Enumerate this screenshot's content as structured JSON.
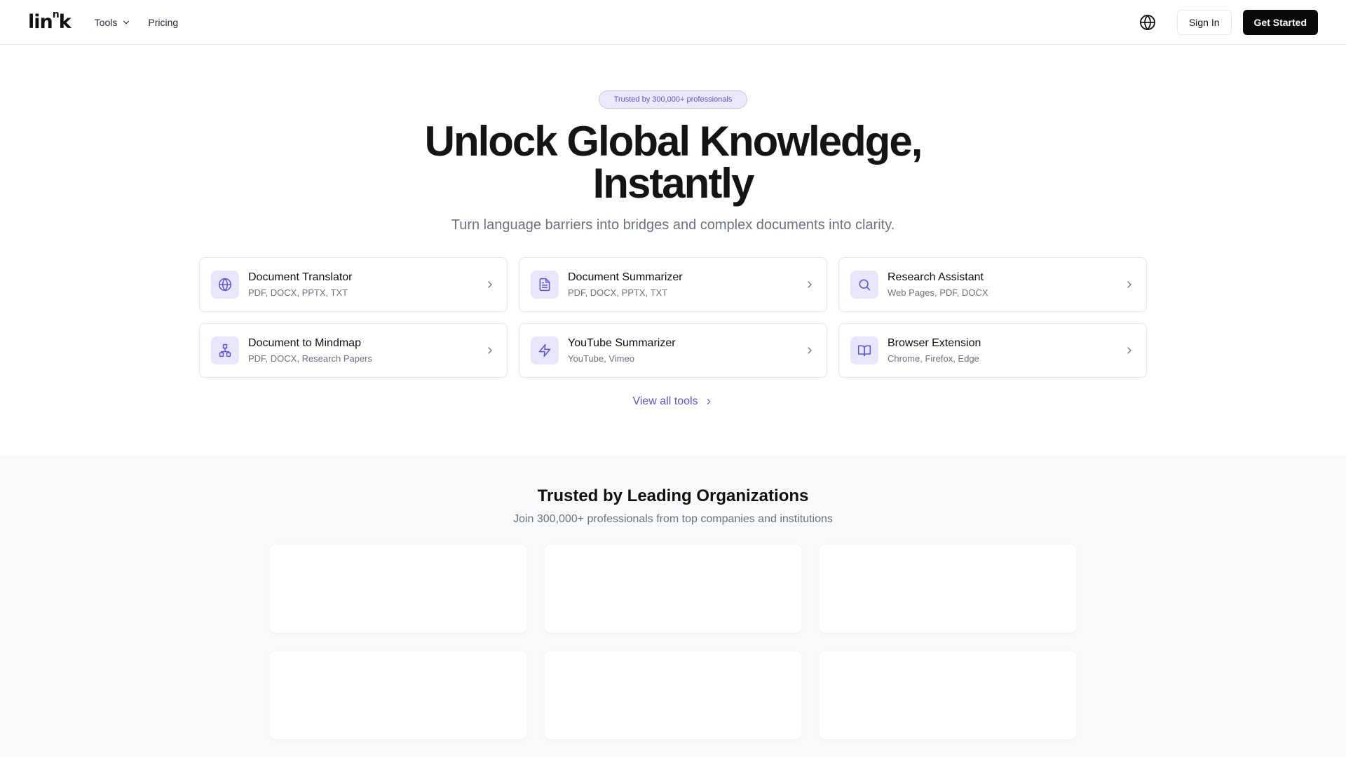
{
  "header": {
    "logo_text": "lin",
    "logo_sup": "n",
    "logo_tail": "k",
    "nav": [
      {
        "label": "Tools"
      },
      {
        "label": "Pricing"
      }
    ],
    "sign_in_label": "Sign In",
    "get_started_label": "Get Started"
  },
  "hero": {
    "badge": "Trusted by 300,000+ professionals",
    "title_line1": "Unlock Global Knowledge,",
    "title_line2": "Instantly",
    "subtitle": "Turn language barriers into bridges and complex documents into clarity.",
    "tools": [
      {
        "name": "Document Translator",
        "formats": "PDF, DOCX, PPTX, TXT",
        "icon": "globe-icon"
      },
      {
        "name": "Document Summarizer",
        "formats": "PDF, DOCX, PPTX, TXT",
        "icon": "document-icon"
      },
      {
        "name": "Research Assistant",
        "formats": "Web Pages, PDF, DOCX",
        "icon": "search-icon"
      },
      {
        "name": "Document to Mindmap",
        "formats": "PDF, DOCX, Research Papers",
        "icon": "mindmap-icon"
      },
      {
        "name": "YouTube Summarizer",
        "formats": "YouTube, Vimeo",
        "icon": "lightning-icon"
      },
      {
        "name": "Browser Extension",
        "formats": "Chrome, Firefox, Edge",
        "icon": "book-icon"
      }
    ],
    "view_all_label": "View all tools"
  },
  "trusted": {
    "title": "Trusted by Leading Organizations",
    "subtitle": "Join 300,000+ professionals from top companies and institutions"
  },
  "colors": {
    "accent": "#5b54d6",
    "icon_bg": "#e7e6fb",
    "primary_button": "#0a0a0a"
  }
}
